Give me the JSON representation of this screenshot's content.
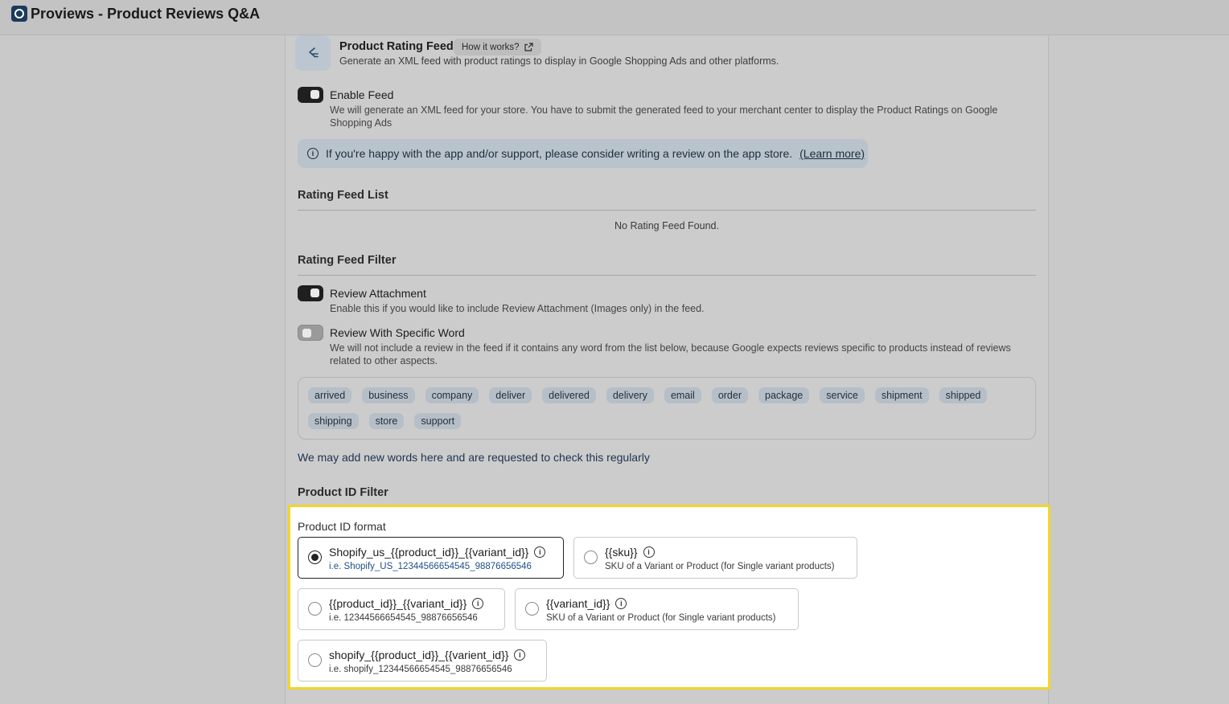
{
  "app": {
    "title": "Proviews - Product Reviews Q&A",
    "logo_icon": "proviews-logo-icon"
  },
  "feed_header": {
    "title": "Product Rating Feed",
    "how_button": "How it works?",
    "description": "Generate an XML feed with product ratings to display in Google Shopping Ads and other platforms."
  },
  "enable_feed": {
    "label": "Enable Feed",
    "enabled": true,
    "description": "We will generate an XML feed for your store. You have to submit the generated feed to your merchant center to display the Product Ratings on Google Shopping Ads"
  },
  "banner": {
    "text": "If you're happy with the app and/or support, please consider writing a review on the app store.",
    "link": "(Learn more)"
  },
  "rating_feed_list": {
    "title": "Rating Feed List",
    "empty": "No Rating Feed Found."
  },
  "rating_feed_filter": {
    "title": "Rating Feed Filter",
    "review_attachment": {
      "label": "Review Attachment",
      "enabled": true,
      "description": "Enable this if you would like to include Review Attachment (Images only) in the feed."
    },
    "specific_word": {
      "label": "Review With Specific Word",
      "enabled": false,
      "description": "We will not include a review in the feed if it contains any word from the list below, because Google expects reviews specific to products instead of reviews related to other aspects."
    },
    "words": [
      "arrived",
      "business",
      "company",
      "deliver",
      "delivered",
      "delivery",
      "email",
      "order",
      "package",
      "service",
      "shipment",
      "shipped",
      "shipping",
      "store",
      "support"
    ],
    "note": "We may add new words here and are requested to check this regularly"
  },
  "product_id_filter": {
    "title": "Product ID Filter",
    "format_label": "Product ID format",
    "options": [
      {
        "title": "Shopify_us_{{product_id}}_{{variant_id}}",
        "sub": "i.e. Shopify_US_12344566654545_98876656546",
        "selected": true
      },
      {
        "title": "{{sku}}",
        "sub": "SKU of a Variant or Product (for Single variant products)",
        "selected": false
      },
      {
        "title": "{{product_id}}_{{variant_id}}",
        "sub": "i.e. 12344566654545_98876656546",
        "selected": false
      },
      {
        "title": "{{variant_id}}",
        "sub": "SKU of a Variant or Product (for Single variant products)",
        "selected": false
      },
      {
        "title": "shopify_{{product_id}}_{{varient_id}}",
        "sub": "i.e. shopify_12344566654545_98876656546",
        "selected": false
      }
    ]
  },
  "colors": {
    "highlight_border": "#f2d626",
    "brand": "#1b3a5c",
    "link": "#1d4f8a"
  }
}
